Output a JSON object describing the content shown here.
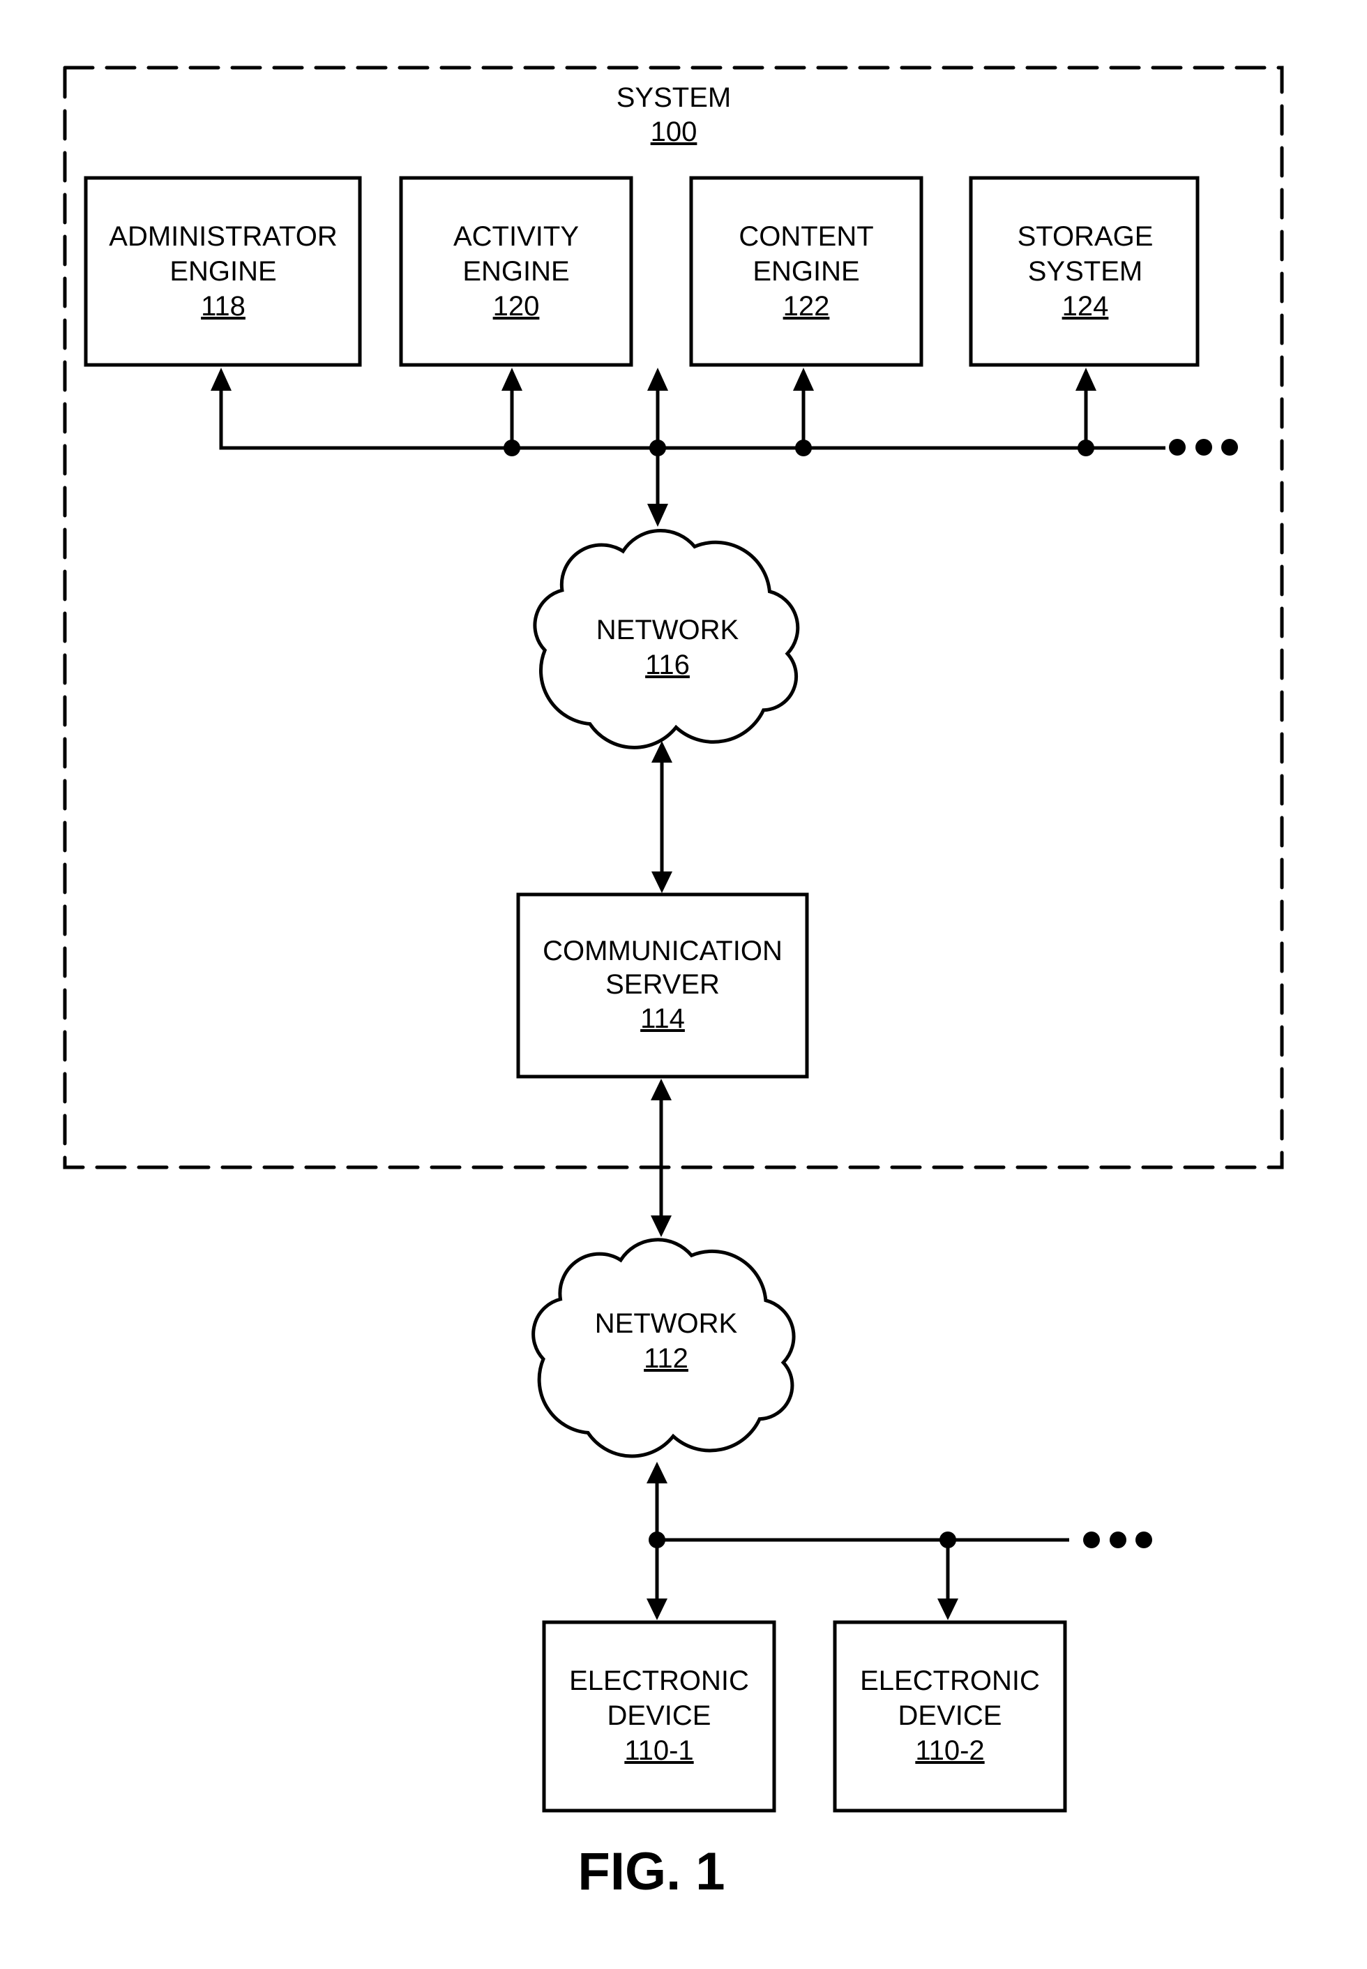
{
  "figure_label": "FIG. 1",
  "system": {
    "name": "SYSTEM",
    "ref": "100"
  },
  "components": {
    "administrator_engine": {
      "lines": [
        "ADMINISTRATOR",
        "ENGINE"
      ],
      "ref": "118"
    },
    "activity_engine": {
      "lines": [
        "ACTIVITY",
        "ENGINE"
      ],
      "ref": "120"
    },
    "content_engine": {
      "lines": [
        "CONTENT",
        "ENGINE"
      ],
      "ref": "122"
    },
    "storage_system": {
      "lines": [
        "STORAGE",
        "SYSTEM"
      ],
      "ref": "124"
    },
    "network_116": {
      "lines": [
        "NETWORK"
      ],
      "ref": "116"
    },
    "communication_server": {
      "lines": [
        "COMMUNICATION",
        "SERVER"
      ],
      "ref": "114"
    },
    "network_112": {
      "lines": [
        "NETWORK"
      ],
      "ref": "112"
    },
    "electronic_device_1": {
      "lines": [
        "ELECTRONIC",
        "DEVICE"
      ],
      "ref": "110-1"
    },
    "electronic_device_2": {
      "lines": [
        "ELECTRONIC",
        "DEVICE"
      ],
      "ref": "110-2"
    }
  },
  "connections": [
    {
      "from": "network_116",
      "to": "administrator_engine",
      "direction": "to"
    },
    {
      "from": "network_116",
      "to": "activity_engine",
      "direction": "to"
    },
    {
      "from": "network_116",
      "to": "content_engine",
      "direction": "to"
    },
    {
      "from": "network_116",
      "to": "storage_system",
      "direction": "to"
    },
    {
      "from": "network_116",
      "to": "bus_internal",
      "direction": "bidirectional"
    },
    {
      "from": "network_116",
      "to": "communication_server",
      "direction": "bidirectional"
    },
    {
      "from": "communication_server",
      "to": "network_112",
      "direction": "bidirectional"
    },
    {
      "from": "network_112",
      "to": "electronic_device_1",
      "direction": "bidirectional"
    },
    {
      "from": "network_112",
      "to": "electronic_device_2",
      "direction": "to"
    }
  ],
  "continuation_marker": "..."
}
